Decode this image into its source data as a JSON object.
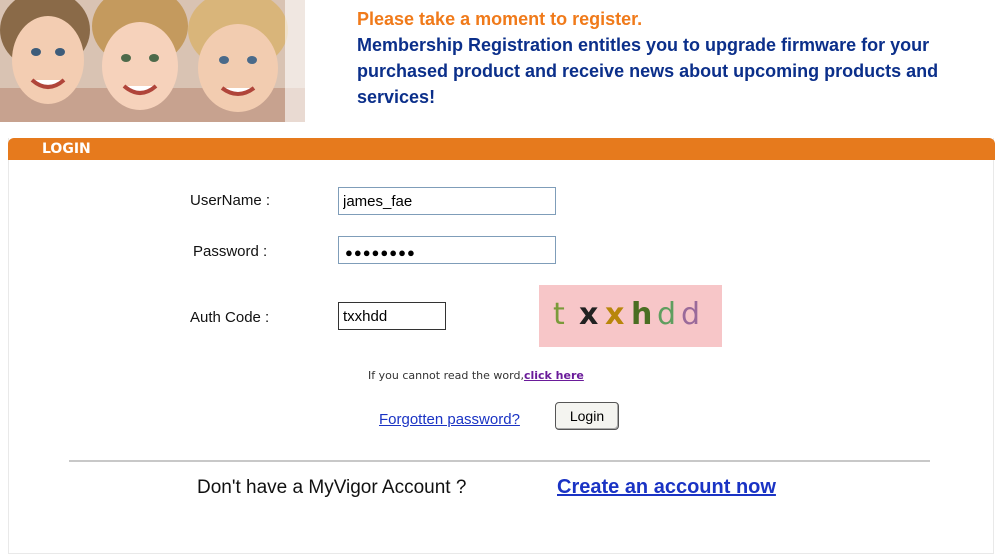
{
  "header": {
    "photo_alt": "children",
    "intro_line1": "Please take a moment to register.",
    "intro_line2": "Membership Registration entitles you to upgrade firmware for your purchased product and receive news about upcoming products and services!"
  },
  "login": {
    "panel_title": "LOGIN",
    "username_label": "UserName :",
    "username_value": "james_fae",
    "password_label": "Password :",
    "password_mask": "●●●●●●●●",
    "authcode_label": "Auth Code :",
    "authcode_value": "txxhdd",
    "captcha_letters": [
      "t",
      "x",
      "x",
      "h",
      "d",
      "d"
    ],
    "captcha_colors": [
      "#7a9a3a",
      "#222222",
      "#b8860b",
      "#4a6e22",
      "#5f9e5f",
      "#9a6a9a"
    ],
    "hint_text": "If you cannot read the word,",
    "hint_link": "click here",
    "forgot_link": "Forgotten password?",
    "login_button": "Login"
  },
  "footer": {
    "no_account_text": "Don't have a MyVigor Account ?",
    "create_link": "Create an account now"
  }
}
